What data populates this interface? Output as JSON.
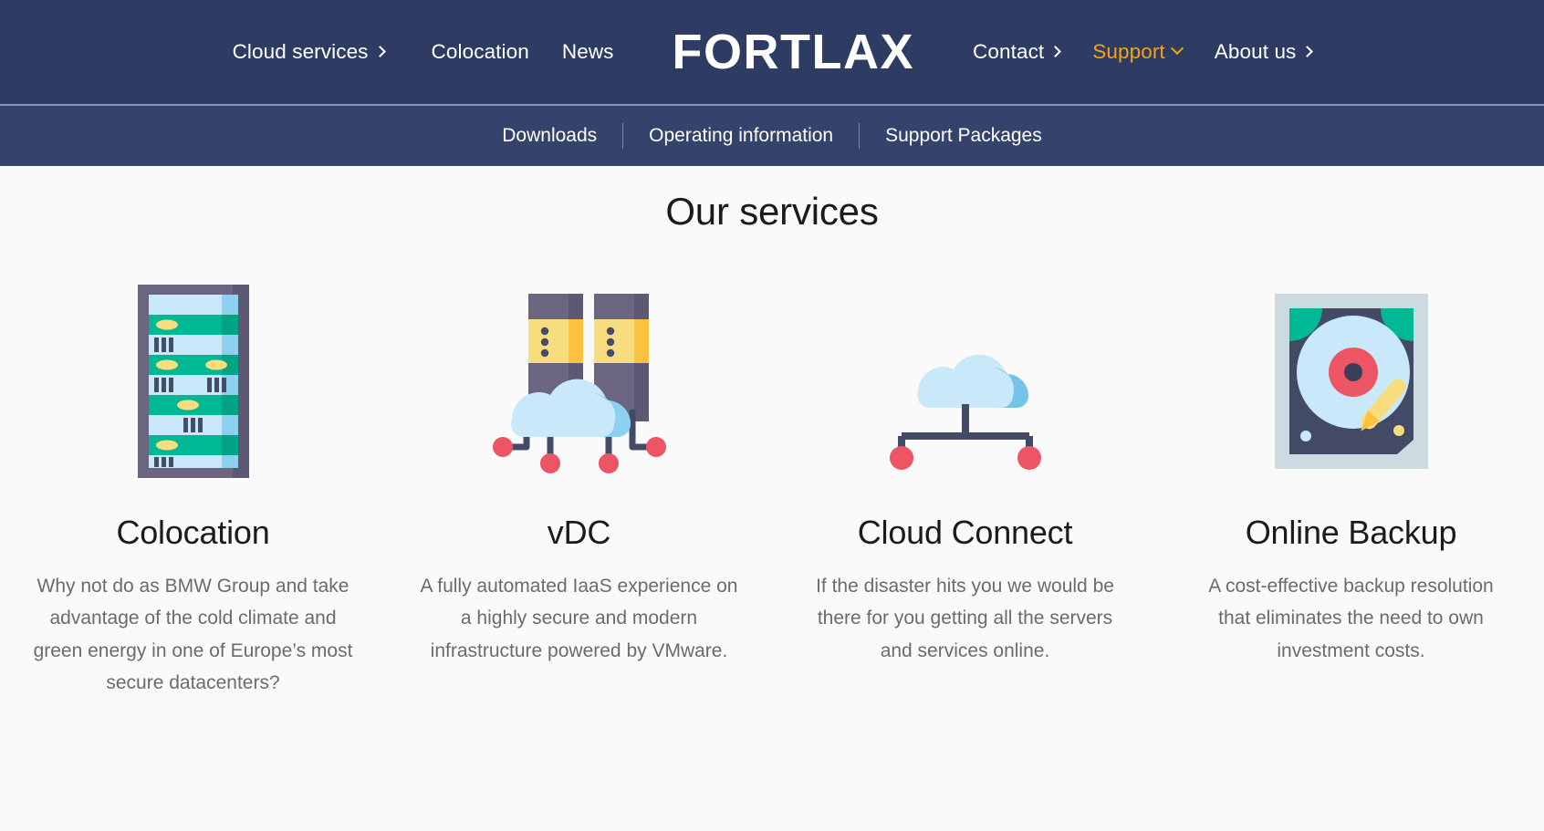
{
  "header": {
    "logo": "FORTLAX",
    "nav_left": [
      {
        "label": "Cloud services",
        "icon": "chevron-right-icon",
        "accent": false
      },
      {
        "label": "Colocation",
        "icon": "",
        "accent": false
      },
      {
        "label": "News",
        "icon": "",
        "accent": false
      }
    ],
    "nav_right": [
      {
        "label": "Contact",
        "icon": "chevron-right-icon",
        "accent": false
      },
      {
        "label": "Support",
        "icon": "chevron-down-icon",
        "accent": true
      },
      {
        "label": "About us",
        "icon": "chevron-right-icon",
        "accent": false
      }
    ],
    "colors": {
      "nav_background": "#2e3c63",
      "subnav_background": "#34426c",
      "accent": "#f5a215",
      "text": "#ffffff"
    }
  },
  "subnav": {
    "items": [
      {
        "label": "Downloads"
      },
      {
        "label": "Operating information"
      },
      {
        "label": "Support Packages"
      }
    ]
  },
  "main": {
    "title": "Our services",
    "cards": [
      {
        "icon": "server-rack-icon",
        "title": "Colocation",
        "description": "Why not do as BMW Group and take advantage of the cold climate and green energy in one of Europe’s most secure datacenters?"
      },
      {
        "icon": "virtual-datacenter-cloud-icon",
        "title": "vDC",
        "description": "A fully automated IaaS experience on a highly secure and modern infrastructure powered by VMware."
      },
      {
        "icon": "cloud-connect-network-icon",
        "title": "Cloud Connect",
        "description": "If the disaster hits you we would be there for you getting all the servers and services online."
      },
      {
        "icon": "hard-disk-drive-icon",
        "title": "Online Backup",
        "description": "A cost-effective backup resolution that eliminates the need to own investment costs."
      }
    ]
  },
  "palette": {
    "page_background": "#fafafa",
    "heading_text": "#1b1b1b",
    "body_text": "#6b6b6b",
    "icon_teal": "#00b894",
    "icon_light_blue": "#c9e9fa",
    "icon_dark_navy": "#464c67",
    "icon_purple_gray": "#6b6581",
    "icon_yellow": "#f8dd7e",
    "icon_yellow_dark": "#fcc23f",
    "icon_red": "#ed5565",
    "icon_slate": "#424a66",
    "icon_pale_blue_gray": "#ccdbe2"
  }
}
